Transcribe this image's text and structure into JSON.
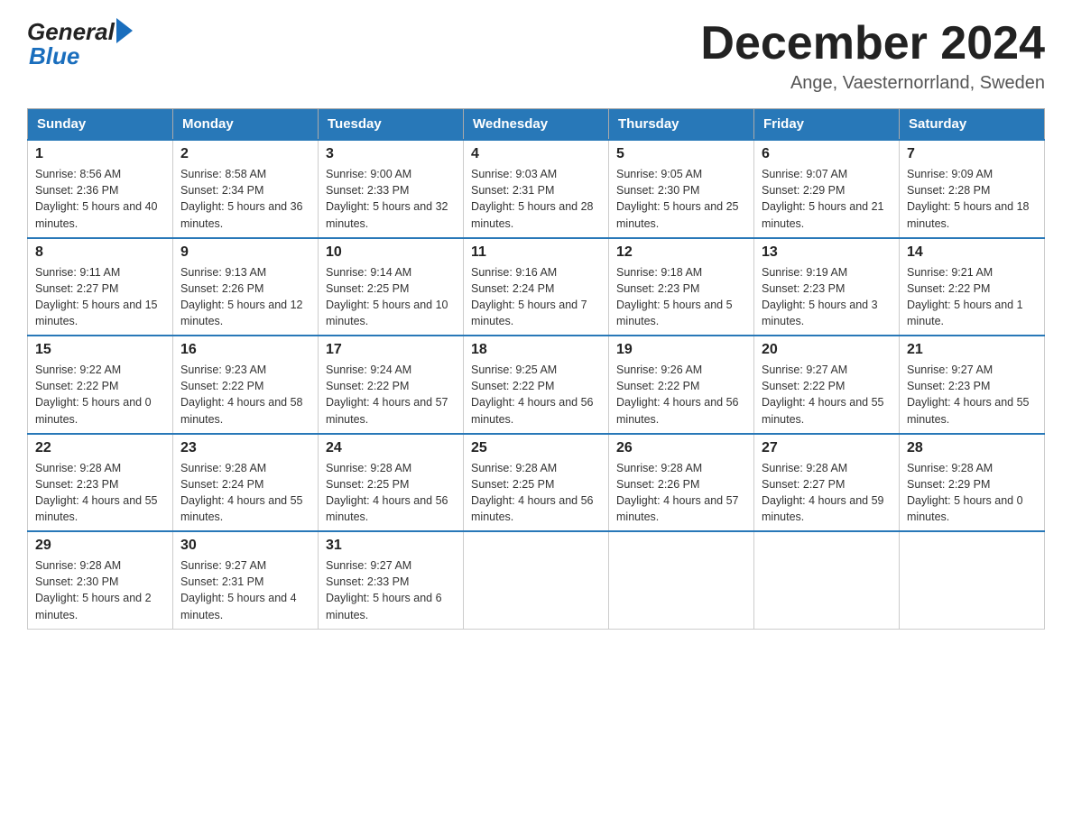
{
  "logo": {
    "general": "General",
    "blue": "Blue"
  },
  "header": {
    "month_title": "December 2024",
    "location": "Ange, Vaesternorrland, Sweden"
  },
  "days_of_week": [
    "Sunday",
    "Monday",
    "Tuesday",
    "Wednesday",
    "Thursday",
    "Friday",
    "Saturday"
  ],
  "weeks": [
    [
      {
        "day": "1",
        "sunrise": "Sunrise: 8:56 AM",
        "sunset": "Sunset: 2:36 PM",
        "daylight": "Daylight: 5 hours and 40 minutes."
      },
      {
        "day": "2",
        "sunrise": "Sunrise: 8:58 AM",
        "sunset": "Sunset: 2:34 PM",
        "daylight": "Daylight: 5 hours and 36 minutes."
      },
      {
        "day": "3",
        "sunrise": "Sunrise: 9:00 AM",
        "sunset": "Sunset: 2:33 PM",
        "daylight": "Daylight: 5 hours and 32 minutes."
      },
      {
        "day": "4",
        "sunrise": "Sunrise: 9:03 AM",
        "sunset": "Sunset: 2:31 PM",
        "daylight": "Daylight: 5 hours and 28 minutes."
      },
      {
        "day": "5",
        "sunrise": "Sunrise: 9:05 AM",
        "sunset": "Sunset: 2:30 PM",
        "daylight": "Daylight: 5 hours and 25 minutes."
      },
      {
        "day": "6",
        "sunrise": "Sunrise: 9:07 AM",
        "sunset": "Sunset: 2:29 PM",
        "daylight": "Daylight: 5 hours and 21 minutes."
      },
      {
        "day": "7",
        "sunrise": "Sunrise: 9:09 AM",
        "sunset": "Sunset: 2:28 PM",
        "daylight": "Daylight: 5 hours and 18 minutes."
      }
    ],
    [
      {
        "day": "8",
        "sunrise": "Sunrise: 9:11 AM",
        "sunset": "Sunset: 2:27 PM",
        "daylight": "Daylight: 5 hours and 15 minutes."
      },
      {
        "day": "9",
        "sunrise": "Sunrise: 9:13 AM",
        "sunset": "Sunset: 2:26 PM",
        "daylight": "Daylight: 5 hours and 12 minutes."
      },
      {
        "day": "10",
        "sunrise": "Sunrise: 9:14 AM",
        "sunset": "Sunset: 2:25 PM",
        "daylight": "Daylight: 5 hours and 10 minutes."
      },
      {
        "day": "11",
        "sunrise": "Sunrise: 9:16 AM",
        "sunset": "Sunset: 2:24 PM",
        "daylight": "Daylight: 5 hours and 7 minutes."
      },
      {
        "day": "12",
        "sunrise": "Sunrise: 9:18 AM",
        "sunset": "Sunset: 2:23 PM",
        "daylight": "Daylight: 5 hours and 5 minutes."
      },
      {
        "day": "13",
        "sunrise": "Sunrise: 9:19 AM",
        "sunset": "Sunset: 2:23 PM",
        "daylight": "Daylight: 5 hours and 3 minutes."
      },
      {
        "day": "14",
        "sunrise": "Sunrise: 9:21 AM",
        "sunset": "Sunset: 2:22 PM",
        "daylight": "Daylight: 5 hours and 1 minute."
      }
    ],
    [
      {
        "day": "15",
        "sunrise": "Sunrise: 9:22 AM",
        "sunset": "Sunset: 2:22 PM",
        "daylight": "Daylight: 5 hours and 0 minutes."
      },
      {
        "day": "16",
        "sunrise": "Sunrise: 9:23 AM",
        "sunset": "Sunset: 2:22 PM",
        "daylight": "Daylight: 4 hours and 58 minutes."
      },
      {
        "day": "17",
        "sunrise": "Sunrise: 9:24 AM",
        "sunset": "Sunset: 2:22 PM",
        "daylight": "Daylight: 4 hours and 57 minutes."
      },
      {
        "day": "18",
        "sunrise": "Sunrise: 9:25 AM",
        "sunset": "Sunset: 2:22 PM",
        "daylight": "Daylight: 4 hours and 56 minutes."
      },
      {
        "day": "19",
        "sunrise": "Sunrise: 9:26 AM",
        "sunset": "Sunset: 2:22 PM",
        "daylight": "Daylight: 4 hours and 56 minutes."
      },
      {
        "day": "20",
        "sunrise": "Sunrise: 9:27 AM",
        "sunset": "Sunset: 2:22 PM",
        "daylight": "Daylight: 4 hours and 55 minutes."
      },
      {
        "day": "21",
        "sunrise": "Sunrise: 9:27 AM",
        "sunset": "Sunset: 2:23 PM",
        "daylight": "Daylight: 4 hours and 55 minutes."
      }
    ],
    [
      {
        "day": "22",
        "sunrise": "Sunrise: 9:28 AM",
        "sunset": "Sunset: 2:23 PM",
        "daylight": "Daylight: 4 hours and 55 minutes."
      },
      {
        "day": "23",
        "sunrise": "Sunrise: 9:28 AM",
        "sunset": "Sunset: 2:24 PM",
        "daylight": "Daylight: 4 hours and 55 minutes."
      },
      {
        "day": "24",
        "sunrise": "Sunrise: 9:28 AM",
        "sunset": "Sunset: 2:25 PM",
        "daylight": "Daylight: 4 hours and 56 minutes."
      },
      {
        "day": "25",
        "sunrise": "Sunrise: 9:28 AM",
        "sunset": "Sunset: 2:25 PM",
        "daylight": "Daylight: 4 hours and 56 minutes."
      },
      {
        "day": "26",
        "sunrise": "Sunrise: 9:28 AM",
        "sunset": "Sunset: 2:26 PM",
        "daylight": "Daylight: 4 hours and 57 minutes."
      },
      {
        "day": "27",
        "sunrise": "Sunrise: 9:28 AM",
        "sunset": "Sunset: 2:27 PM",
        "daylight": "Daylight: 4 hours and 59 minutes."
      },
      {
        "day": "28",
        "sunrise": "Sunrise: 9:28 AM",
        "sunset": "Sunset: 2:29 PM",
        "daylight": "Daylight: 5 hours and 0 minutes."
      }
    ],
    [
      {
        "day": "29",
        "sunrise": "Sunrise: 9:28 AM",
        "sunset": "Sunset: 2:30 PM",
        "daylight": "Daylight: 5 hours and 2 minutes."
      },
      {
        "day": "30",
        "sunrise": "Sunrise: 9:27 AM",
        "sunset": "Sunset: 2:31 PM",
        "daylight": "Daylight: 5 hours and 4 minutes."
      },
      {
        "day": "31",
        "sunrise": "Sunrise: 9:27 AM",
        "sunset": "Sunset: 2:33 PM",
        "daylight": "Daylight: 5 hours and 6 minutes."
      },
      null,
      null,
      null,
      null
    ]
  ]
}
